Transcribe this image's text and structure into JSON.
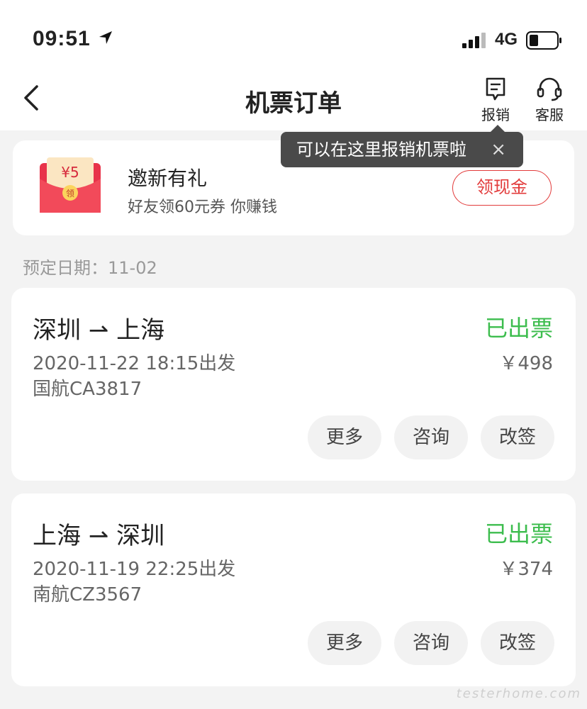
{
  "status_bar": {
    "time": "09:51",
    "network": "4G"
  },
  "nav": {
    "title": "机票订单",
    "reimburse_label": "报销",
    "service_label": "客服"
  },
  "tooltip": {
    "text": "可以在这里报销机票啦",
    "close": "×"
  },
  "promo": {
    "title": "邀新有礼",
    "subtitle": "好友领60元券 你赚钱",
    "button": "领现金",
    "envelope_amount": "¥5",
    "envelope_badge": "领"
  },
  "booking_date": "预定日期：11-02",
  "orders": [
    {
      "route": "深圳 ⇀ 上海",
      "status": "已出票",
      "depart": "2020-11-22 18:15出发",
      "price": "￥498",
      "flight": "国航CA3817",
      "actions": [
        "更多",
        "咨询",
        "改签"
      ]
    },
    {
      "route": "上海 ⇀ 深圳",
      "status": "已出票",
      "depart": "2020-11-19 22:25出发",
      "price": "￥374",
      "flight": "南航CZ3567",
      "actions": [
        "更多",
        "咨询",
        "改签"
      ]
    }
  ],
  "watermark": "testerhome.com",
  "colors": {
    "status_green": "#3dbd4e",
    "promo_red": "#e23b3b",
    "tooltip_bg": "#4a4a4a"
  },
  "icons": [
    "location-arrow-icon",
    "signal-icon",
    "battery-icon",
    "back-icon",
    "receipt-icon",
    "headset-icon",
    "close-icon",
    "red-envelope-icon"
  ]
}
